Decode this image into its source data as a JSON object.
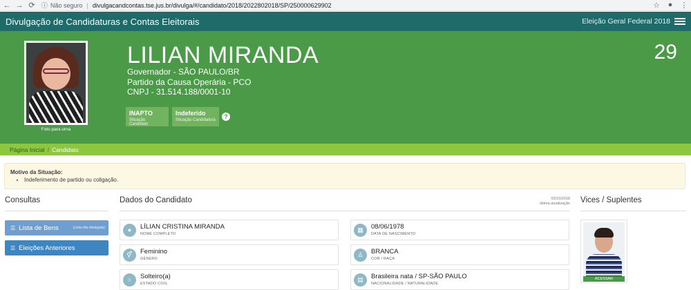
{
  "browser": {
    "insecure": "Não seguro",
    "url": "divulgacandcontas.tse.jus.br/divulga/#/candidato/2018/2022802018/SP/250000629902"
  },
  "topbar": {
    "title": "Divulgação de Candidaturas e Contas Eleitorais",
    "election": "Eleição Geral Federal 2018"
  },
  "candidate": {
    "name": "LILIAN MIRANDA",
    "office": "Governador - SÃO PAULO/BR",
    "party": "Partido da Causa Operária - PCO",
    "cnpj": "CNPJ - 31.514.188/0001-10",
    "number": "29",
    "photo_caption": "Foto para urna",
    "status": {
      "value": "INAPTO",
      "label": "Situação Candidato"
    },
    "candidacy": {
      "value": "Indeferido",
      "label": "Situação Candidatura"
    }
  },
  "breadcrumb": {
    "home": "Página Inicial",
    "current": "Candidato"
  },
  "alert": {
    "title": "Motivo da Situação:",
    "items": [
      "Indeferimento de partido ou coligação."
    ]
  },
  "consultas": {
    "title": "Consultas",
    "bens": {
      "label": "Lista de Bens",
      "note": "(Lista não divulgada)"
    },
    "eleicoes": {
      "label": "Eleições Anteriores"
    }
  },
  "dados": {
    "title": "Dados do Candidato",
    "updated_date": "03/10/2018",
    "updated_label": "última atualização",
    "fields": [
      {
        "value": "LÍLIAN CRISTINA MIRANDA",
        "label": "NOME COMPLETO",
        "icon": "user-icon"
      },
      {
        "value": "08/06/1978",
        "label": "DATA DE NASCIMENTO",
        "icon": "calendar-icon"
      },
      {
        "value": "Feminino",
        "label": "GÊNERO",
        "icon": "gender-icon"
      },
      {
        "value": "BRANCA",
        "label": "COR / RAÇA",
        "icon": "person-icon"
      },
      {
        "value": "Solteiro(a)",
        "label": "ESTADO CIVIL",
        "icon": "ring-icon"
      },
      {
        "value": "Brasileira nata / SP-SÃO PAULO",
        "label": "NACIONALIDADE / NATURALIDADE",
        "icon": "map-icon"
      }
    ]
  },
  "vices": {
    "title": "Vices / Suplentes",
    "access": "ACESSAR"
  },
  "colors": {
    "topbar": "#1f6b69",
    "header": "#4a9a48",
    "breadcrumb": "#8dc63f",
    "button": "#3f85c1"
  }
}
